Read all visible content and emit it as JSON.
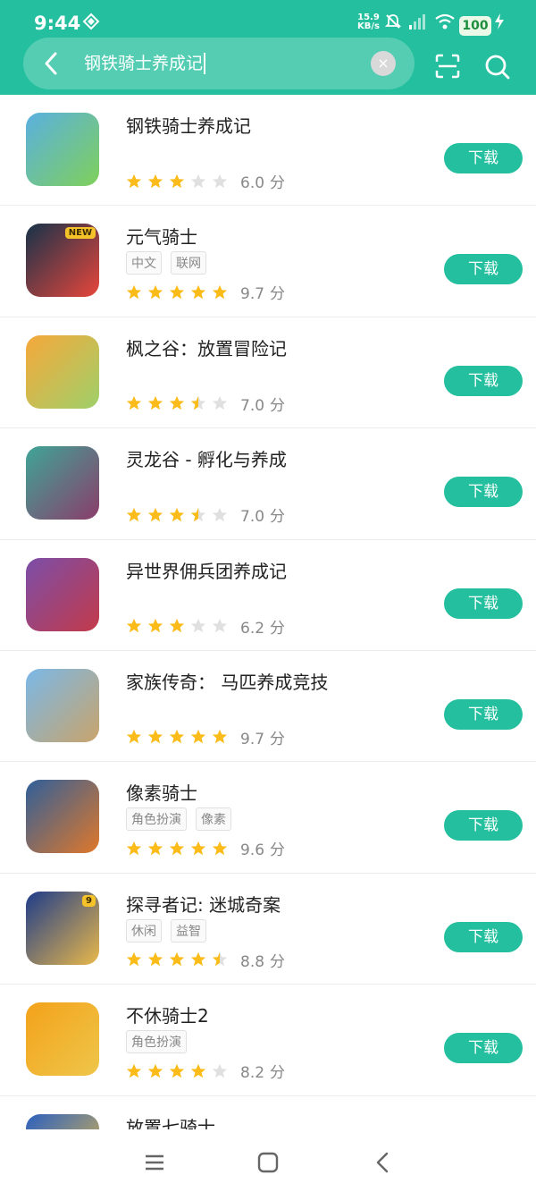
{
  "status": {
    "time": "9:44",
    "speed": "15.9",
    "speed_unit": "KB/s",
    "battery": "100"
  },
  "search": {
    "query": "钢铁骑士养成记",
    "clear": "×"
  },
  "download_label": "下载",
  "score_unit": "分",
  "apps": [
    {
      "name": "钢铁骑士养成记",
      "tags": [],
      "stars": 3,
      "score": "6.0",
      "icon_colors": [
        "#5ab0e0",
        "#7fd05a"
      ]
    },
    {
      "name": "元气骑士",
      "tags": [
        "中文",
        "联网"
      ],
      "stars": 5,
      "score": "9.7",
      "icon_colors": [
        "#16324a",
        "#e8463b"
      ],
      "badge": "NEW"
    },
    {
      "name": "枫之谷：放置冒险记",
      "tags": [],
      "stars": 3.5,
      "score": "7.0",
      "icon_colors": [
        "#f6a83a",
        "#9fd06a"
      ]
    },
    {
      "name": "灵龙谷 - 孵化与养成",
      "tags": [],
      "stars": 3.5,
      "score": "7.0",
      "icon_colors": [
        "#3fa597",
        "#8a3d6a"
      ]
    },
    {
      "name": "异世界佣兵团养成记",
      "tags": [],
      "stars": 3,
      "score": "6.2",
      "icon_colors": [
        "#7b4ea8",
        "#c33a4a"
      ]
    },
    {
      "name": "家族传奇： 马匹养成竞技",
      "tags": [],
      "stars": 5,
      "score": "9.7",
      "icon_colors": [
        "#7ab8e8",
        "#c9a46b"
      ]
    },
    {
      "name": "像素骑士",
      "tags": [
        "角色扮演",
        "像素"
      ],
      "stars": 5,
      "score": "9.6",
      "icon_colors": [
        "#2f5f9a",
        "#e0782a"
      ]
    },
    {
      "name": "探寻者记: 迷城奇案",
      "tags": [
        "休闲",
        "益智"
      ],
      "stars": 4.5,
      "score": "8.8",
      "icon_colors": [
        "#1e3c8a",
        "#e9b84a"
      ],
      "badge": "9"
    },
    {
      "name": "不休骑士2",
      "tags": [
        "角色扮演"
      ],
      "stars": 4,
      "score": "8.2",
      "icon_colors": [
        "#f4a21a",
        "#eec64a"
      ]
    },
    {
      "name": "放置七骑士",
      "tags": [],
      "stars": 0,
      "score": "",
      "icon_colors": [
        "#2a5fc0",
        "#f0c040"
      ]
    }
  ],
  "colors": {
    "accent": "#24bf9e",
    "star": "#fbbc1a",
    "star_empty": "#e0e0e0"
  }
}
